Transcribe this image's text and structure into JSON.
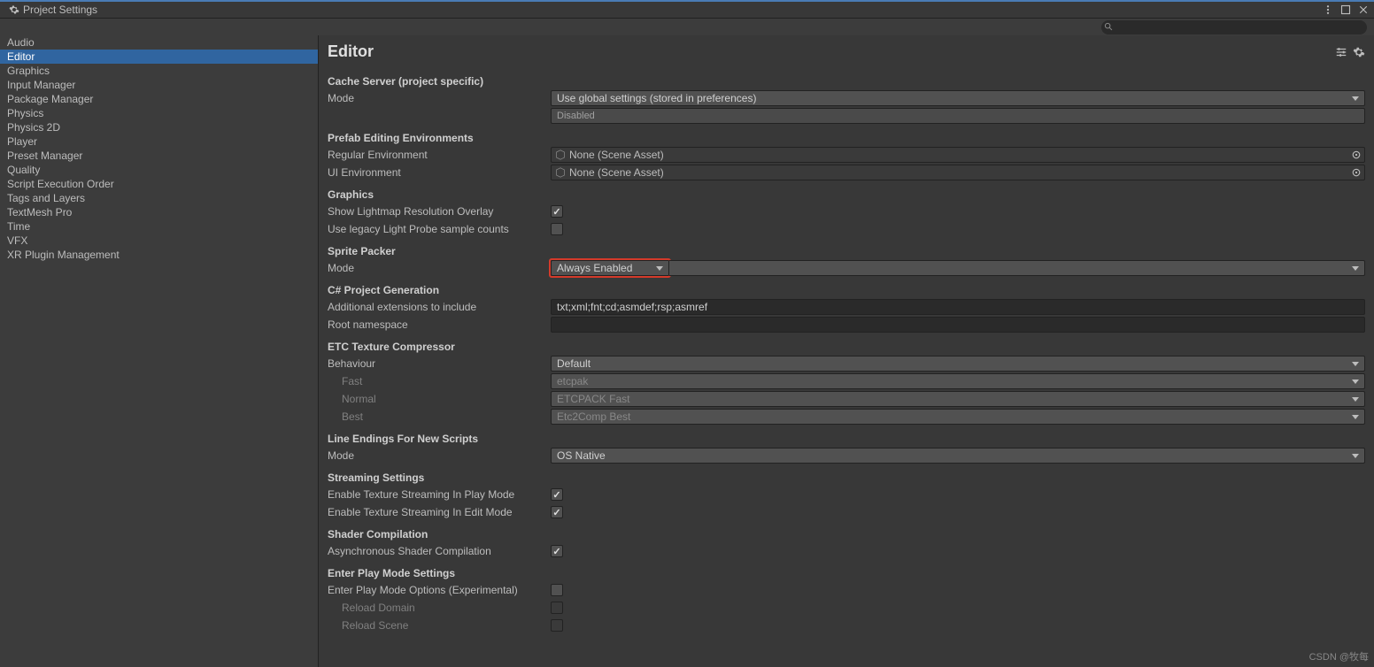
{
  "window": {
    "title": "Project Settings"
  },
  "sidebar": {
    "items": [
      {
        "label": "Audio",
        "selected": false
      },
      {
        "label": "Editor",
        "selected": true
      },
      {
        "label": "Graphics",
        "selected": false
      },
      {
        "label": "Input Manager",
        "selected": false
      },
      {
        "label": "Package Manager",
        "selected": false
      },
      {
        "label": "Physics",
        "selected": false
      },
      {
        "label": "Physics 2D",
        "selected": false
      },
      {
        "label": "Player",
        "selected": false
      },
      {
        "label": "Preset Manager",
        "selected": false
      },
      {
        "label": "Quality",
        "selected": false
      },
      {
        "label": "Script Execution Order",
        "selected": false
      },
      {
        "label": "Tags and Layers",
        "selected": false
      },
      {
        "label": "TextMesh Pro",
        "selected": false
      },
      {
        "label": "Time",
        "selected": false
      },
      {
        "label": "VFX",
        "selected": false
      },
      {
        "label": "XR Plugin Management",
        "selected": false
      }
    ]
  },
  "page": {
    "title": "Editor",
    "cache_server": {
      "heading": "Cache Server (project specific)",
      "mode_label": "Mode",
      "mode_value": "Use global settings (stored in preferences)",
      "status": "Disabled"
    },
    "prefab": {
      "heading": "Prefab Editing Environments",
      "regular_label": "Regular Environment",
      "regular_value": "None (Scene Asset)",
      "ui_label": "UI Environment",
      "ui_value": "None (Scene Asset)"
    },
    "graphics": {
      "heading": "Graphics",
      "lightmap_label": "Show Lightmap Resolution Overlay",
      "lightmap_checked": true,
      "legacy_label": "Use legacy Light Probe sample counts",
      "legacy_checked": false
    },
    "sprite": {
      "heading": "Sprite Packer",
      "mode_label": "Mode",
      "mode_value": "Always Enabled"
    },
    "csproj": {
      "heading": "C# Project Generation",
      "ext_label": "Additional extensions to include",
      "ext_value": "txt;xml;fnt;cd;asmdef;rsp;asmref",
      "ns_label": "Root namespace",
      "ns_value": ""
    },
    "etc": {
      "heading": "ETC Texture Compressor",
      "behaviour_label": "Behaviour",
      "behaviour_value": "Default",
      "fast_label": "Fast",
      "fast_value": "etcpak",
      "normal_label": "Normal",
      "normal_value": "ETCPACK Fast",
      "best_label": "Best",
      "best_value": "Etc2Comp Best"
    },
    "lineendings": {
      "heading": "Line Endings For New Scripts",
      "mode_label": "Mode",
      "mode_value": "OS Native"
    },
    "streaming": {
      "heading": "Streaming Settings",
      "play_label": "Enable Texture Streaming In Play Mode",
      "play_checked": true,
      "edit_label": "Enable Texture Streaming In Edit Mode",
      "edit_checked": true
    },
    "shader": {
      "heading": "Shader Compilation",
      "async_label": "Asynchronous Shader Compilation",
      "async_checked": true
    },
    "playmode": {
      "heading": "Enter Play Mode Settings",
      "options_label": "Enter Play Mode Options (Experimental)",
      "options_checked": false,
      "reload_domain_label": "Reload Domain",
      "reload_scene_label": "Reload Scene"
    }
  },
  "watermark": "CSDN @牧每"
}
